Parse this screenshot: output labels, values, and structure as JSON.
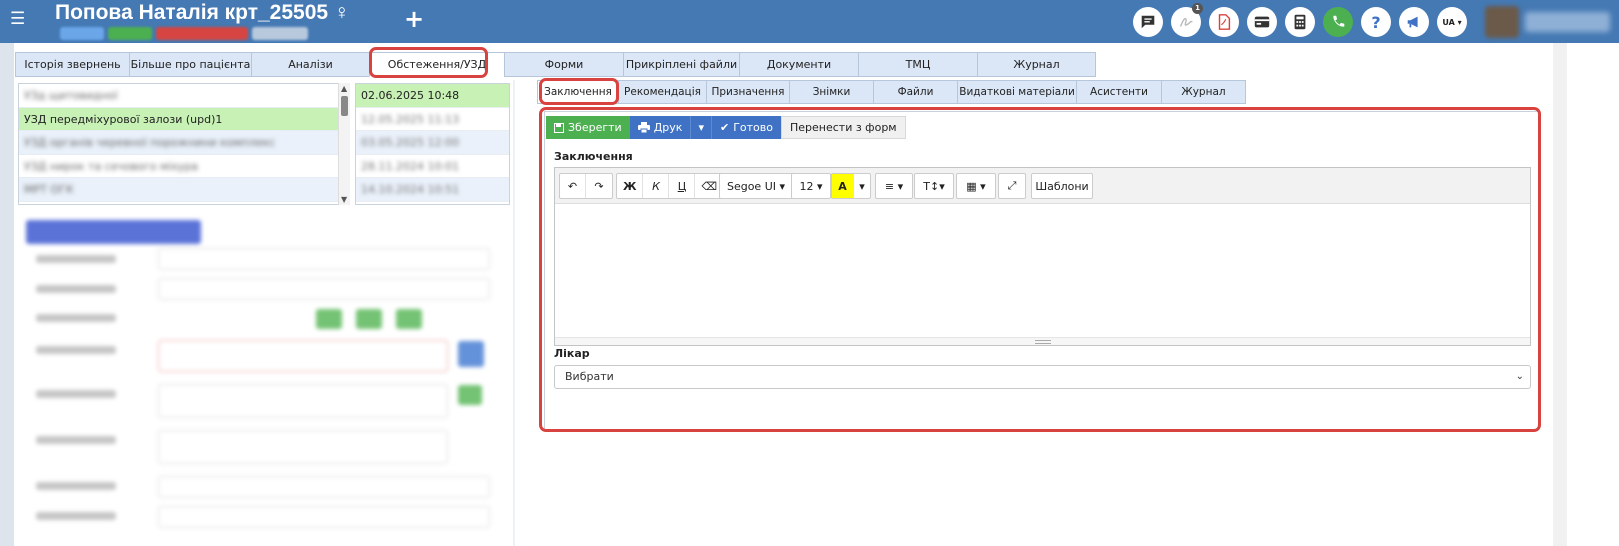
{
  "header": {
    "menu_icon": "☰",
    "patient_title": "Попова Наталія крт_25505 ♀",
    "add_icon": "+",
    "chip_colors": [
      "#6aa6e8",
      "#4caf50",
      "#d64541",
      "#b8c9dd"
    ],
    "icons": [
      {
        "name": "chat-icon",
        "glyph": "💬"
      },
      {
        "name": "signature-icon",
        "glyph": "✍",
        "badge": "1"
      },
      {
        "name": "pdf-icon",
        "glyph": "PDF"
      },
      {
        "name": "card-icon",
        "glyph": "▭"
      },
      {
        "name": "calculator-icon",
        "glyph": "▦"
      },
      {
        "name": "phone-icon",
        "glyph": "✆"
      },
      {
        "name": "help-icon",
        "glyph": "?"
      },
      {
        "name": "megaphone-icon",
        "glyph": "📢"
      }
    ],
    "lang": "UA ▾"
  },
  "top_tabs": [
    {
      "label": "Історія звернень",
      "active": false
    },
    {
      "label": "Більше про пацієнта",
      "active": false
    },
    {
      "label": "Аналізи",
      "active": false
    },
    {
      "label": "Обстеження/УЗД",
      "active": true
    },
    {
      "label": "Форми",
      "active": false
    },
    {
      "label": "Прикріплені файли",
      "active": false
    },
    {
      "label": "Документи",
      "active": false
    },
    {
      "label": "ТМЦ",
      "active": false
    },
    {
      "label": "Журнал",
      "active": false
    }
  ],
  "research_list": [
    {
      "label": "УЗд щитовидної",
      "blurred": true,
      "selected": false
    },
    {
      "label": "УЗД передміхурової залози (upd)1",
      "blurred": false,
      "selected": true
    },
    {
      "label": "УЗД органів черевної порожнини комплекс",
      "blurred": true,
      "selected": false
    },
    {
      "label": "УЗД нирок та сечового міхура",
      "blurred": true,
      "selected": false
    },
    {
      "label": "МРТ ОГК",
      "blurred": true,
      "selected": false
    }
  ],
  "date_list": [
    {
      "label": "02.06.2025 10:48",
      "blurred": false,
      "selected": true
    },
    {
      "label": "12.05.2025 11:13",
      "blurred": true,
      "selected": false
    },
    {
      "label": "03.05.2025 12:00",
      "blurred": true,
      "selected": false
    },
    {
      "label": "28.11.2024 10:01",
      "blurred": true,
      "selected": false
    },
    {
      "label": "14.10.2024 10:51",
      "blurred": true,
      "selected": false
    }
  ],
  "sub_tabs": [
    {
      "label": "Заключення",
      "active": true
    },
    {
      "label": "Рекомендація",
      "active": false
    },
    {
      "label": "Призначення",
      "active": false
    },
    {
      "label": "Знімки",
      "active": false
    },
    {
      "label": "Файли",
      "active": false
    },
    {
      "label": "Видаткові матеріали",
      "active": false
    },
    {
      "label": "Асистенти",
      "active": false
    },
    {
      "label": "Журнал",
      "active": false
    }
  ],
  "actions": {
    "save": "Зберегти",
    "print": "Друк",
    "print_dropdown": "▾",
    "done": "Готово",
    "transfer": "Перенести з форм"
  },
  "editor": {
    "label": "Заключення",
    "toolbar": {
      "undo": "↶",
      "redo": "↷",
      "bold": "Ж",
      "italic": "К",
      "underline": "Ц",
      "eraser": "⌫",
      "font": "Segoe UI ▾",
      "size": "12 ▾",
      "color": "A",
      "color_dd": "▾",
      "align": "≡ ▾",
      "text_style": "T↕▾",
      "table": "▦ ▾",
      "fullscreen": "⤢",
      "templates": "Шаблони"
    },
    "content": ""
  },
  "doctor": {
    "label": "Лікар",
    "selected": "Вибрати"
  }
}
